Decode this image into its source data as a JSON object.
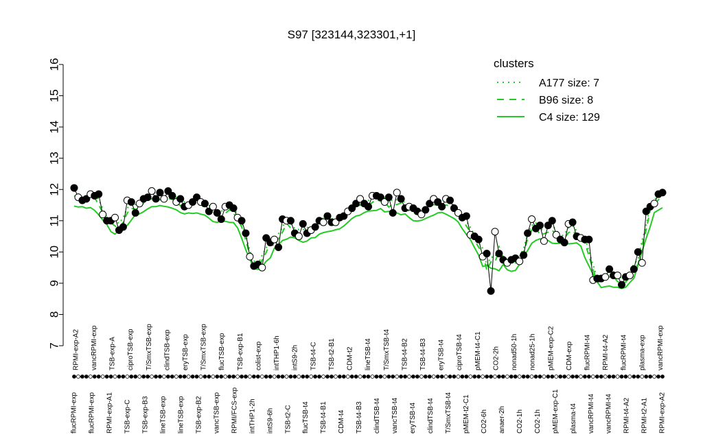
{
  "chart_data": {
    "type": "line",
    "title": "S97 [323144,323301,+1]",
    "xlabel": "",
    "ylabel": "",
    "ylim": [
      7,
      16
    ],
    "yticks": [
      7,
      8,
      9,
      10,
      11,
      12,
      13,
      14,
      15,
      16
    ],
    "legend": {
      "title": "clusters",
      "placement": "top-right",
      "color": "#22cc22",
      "entries": [
        "A177 size: 7",
        "B96 size: 8",
        "C4 size: 129"
      ]
    },
    "tick_labels_top": [
      "RPMI-exp-A2",
      "vancRPMI-exp",
      "TSB-exp-A",
      "ciproTSB-exp",
      "T/SmxTSB-exp",
      "clindTSB-exp",
      "eryTSB-exp",
      "T/SmxTSB-exp",
      "flucTSB-exp",
      "TSB-exp-B1",
      "colist-exp",
      "intTHP1-6h",
      "intS9-2h",
      "TSB-t4-C",
      "TSB-t2-B1",
      "CDM-t2",
      "lineTSB-t4",
      "T/SmxTSB-t4",
      "TSB-t4-B2",
      "TSB-t4-B3",
      "eryTSB-t4",
      "ciproTSB-t4",
      "pMEM-t4-C1",
      "CO2-2h",
      "nonad50-1h",
      "nonad25-1h",
      "pMEM-exp-C2",
      "CDM-exp",
      "flucRPMI-t4",
      "RPMI-t4-A2",
      "flucRPMI-t4",
      "plasma-exp",
      "vancRPMI-exp"
    ],
    "tick_labels_bottom": [
      "flucRPMI-exp",
      "flucRPMI-exp",
      "RPMI-exp-A1",
      "TSB-exp-C",
      "TSB-exp-B3",
      "lineTSB-exp",
      "lineTSB-exp",
      "TSB-exp-B2",
      "vancTSB-exp",
      "RPMI/FCS-exp",
      "intTHP1-2h",
      "intS9-6h",
      "TSB-t2-C",
      "flucTSB-t4",
      "TSB-t4-B1",
      "CDM-t4",
      "TSB-t4-B3",
      "clindTSB-t4",
      "vancTSB-t4",
      "eryTSB-t4",
      "clindTSB-t4",
      "T/SmxTSB-t4",
      "pMEM-t2-C1",
      "CO2-6h",
      "anaer-2h",
      "CO2-1h",
      "CO2-1h",
      "pMEM-exp-C1",
      "plasma-t4",
      "vancRPMI-t4",
      "vancRPMI-t4",
      "RPMI-t4-A2",
      "RPMI-t2-A1",
      "RPMI-exp-A2"
    ],
    "series": [
      {
        "values": [
          12.05,
          11.75,
          11.65,
          11.7,
          11.85,
          11.8,
          11.85,
          11.2,
          11.0,
          11.0,
          11.1,
          10.7,
          10.8,
          11.65,
          11.6,
          11.25,
          11.55,
          11.7,
          11.75,
          11.95,
          11.7,
          11.9,
          11.7,
          11.95,
          11.8,
          11.6,
          11.7,
          11.45,
          11.5,
          11.6,
          11.75,
          11.6,
          11.55,
          11.3,
          11.45,
          11.25,
          11.05,
          11.45,
          11.5,
          11.4,
          11.1,
          11.0,
          10.6,
          9.85,
          9.55,
          9.6,
          9.5,
          10.45,
          10.3,
          10.4,
          10.15,
          11.05,
          11.0,
          11.0,
          10.6,
          10.5,
          10.9,
          10.6,
          10.7,
          10.8,
          11.0,
          10.95,
          11.15,
          10.95,
          10.95,
          11.1,
          11.15,
          11.3,
          11.4,
          11.55,
          11.7,
          11.55,
          11.45,
          11.8,
          11.8,
          11.75,
          11.6,
          11.75,
          11.25,
          11.9,
          11.7,
          11.4,
          11.45,
          11.4,
          11.3,
          11.2,
          11.35,
          11.55,
          11.7,
          11.6,
          11.45,
          11.7,
          11.65,
          11.4,
          11.25,
          11.1,
          11.15,
          10.55,
          10.5,
          10.4,
          9.85,
          9.95,
          8.75,
          10.65,
          9.95,
          9.75,
          9.65,
          9.75,
          9.8,
          9.7,
          9.9,
          10.6,
          11.05,
          10.75,
          10.85,
          10.35,
          10.85,
          11.0,
          10.55,
          10.4,
          10.3,
          10.9,
          10.95,
          10.5,
          10.45,
          10.4,
          10.4,
          9.1,
          9.15,
          9.15,
          9.2,
          9.45,
          9.25,
          9.25,
          8.95,
          9.2,
          9.25,
          9.45,
          10.0,
          9.65,
          11.3,
          11.45,
          11.55,
          11.85,
          11.9
        ]
      }
    ]
  }
}
